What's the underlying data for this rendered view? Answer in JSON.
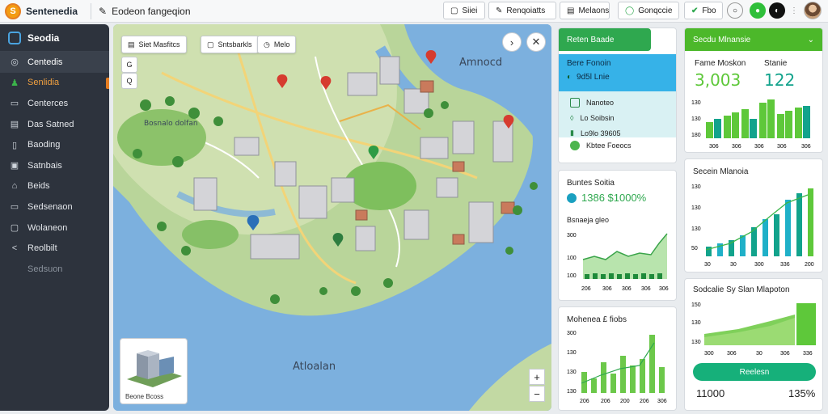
{
  "topbar": {
    "brand": "Sentenedia",
    "page_selector": "Eodeon fangeqion",
    "buttons": [
      "Siiei",
      "Renqoiatts",
      "Melaons"
    ],
    "status_button": "Gonqccie",
    "check_label": "Fbo"
  },
  "sidebar": {
    "title": "Seodia",
    "items": [
      {
        "label": "Centedis",
        "icon": "layers-icon"
      },
      {
        "label": "Senlidia",
        "icon": "person-icon"
      },
      {
        "label": "Centerces",
        "icon": "chat-icon"
      },
      {
        "label": "Das Satned",
        "icon": "calendar-icon"
      },
      {
        "label": "Baoding",
        "icon": "lock-icon"
      },
      {
        "label": "Satnbais",
        "icon": "report-icon"
      },
      {
        "label": "Beids",
        "icon": "home-icon"
      },
      {
        "label": "Sedsenaon",
        "icon": "monitor-icon"
      },
      {
        "label": "Wolaneon",
        "icon": "chat2-icon"
      },
      {
        "label": "Reolbilt",
        "icon": "share-icon"
      },
      {
        "label": "Sedsuon",
        "icon": ""
      }
    ]
  },
  "map": {
    "chips": [
      "Siet Masfitcs",
      "Sntsbarkls",
      "Melo"
    ],
    "tools": [
      "G",
      "Q"
    ],
    "labels": {
      "north": "Amnocd",
      "south": "Atloalan",
      "district": "Bosnalo dolfan"
    },
    "minicard_caption": "Beone Bcoss"
  },
  "card_overview": {
    "header": "Reten Baade",
    "blue_title": "Bere Fonoin",
    "blue_line": "9d5l Lnie",
    "rows": [
      "Nanoteo",
      "Lo Soibsin",
      "Lo9lo 39605"
    ],
    "footer": "Kbtee Foeocs"
  },
  "card_ratio": {
    "title": "Buntes Soitia",
    "value": "1386 $1000%",
    "subtitle": "Bsnaeja gleo",
    "y_ticks": [
      "300",
      "100",
      "100"
    ],
    "x_ticks": [
      "206",
      "306",
      "306",
      "306",
      "306"
    ]
  },
  "card_bars": {
    "title": "Mohenea £ fiobs",
    "y_ticks": [
      "300",
      "130",
      "130",
      "130"
    ],
    "x_ticks": [
      "206",
      "206",
      "200",
      "206",
      "306"
    ]
  },
  "card_stats": {
    "header": "Secdu Mlnansie",
    "label_left": "Fame Moskon",
    "label_right": "Stanie",
    "value_left": "3,003",
    "value_right": "122",
    "y_ticks": [
      "130",
      "130",
      "180"
    ],
    "x_ticks": [
      "306",
      "306",
      "306",
      "306",
      "306"
    ],
    "colors": {
      "green": "#5ec83a",
      "teal": "#12a38c"
    }
  },
  "card_trend": {
    "title": "Secein Mlanoia",
    "y_ticks": [
      "130",
      "130",
      "130",
      "50"
    ],
    "x_ticks": [
      "30",
      "30",
      "300",
      "336",
      "200"
    ]
  },
  "card_area": {
    "title": "Sodcalie Sy Slan Mlapoton",
    "y_ticks": [
      "150",
      "130",
      "130"
    ],
    "x_ticks": [
      "300",
      "306",
      "30",
      "306",
      "336"
    ],
    "button": "Reelesn",
    "stat_left": "11000",
    "stat_right": "135%"
  }
}
